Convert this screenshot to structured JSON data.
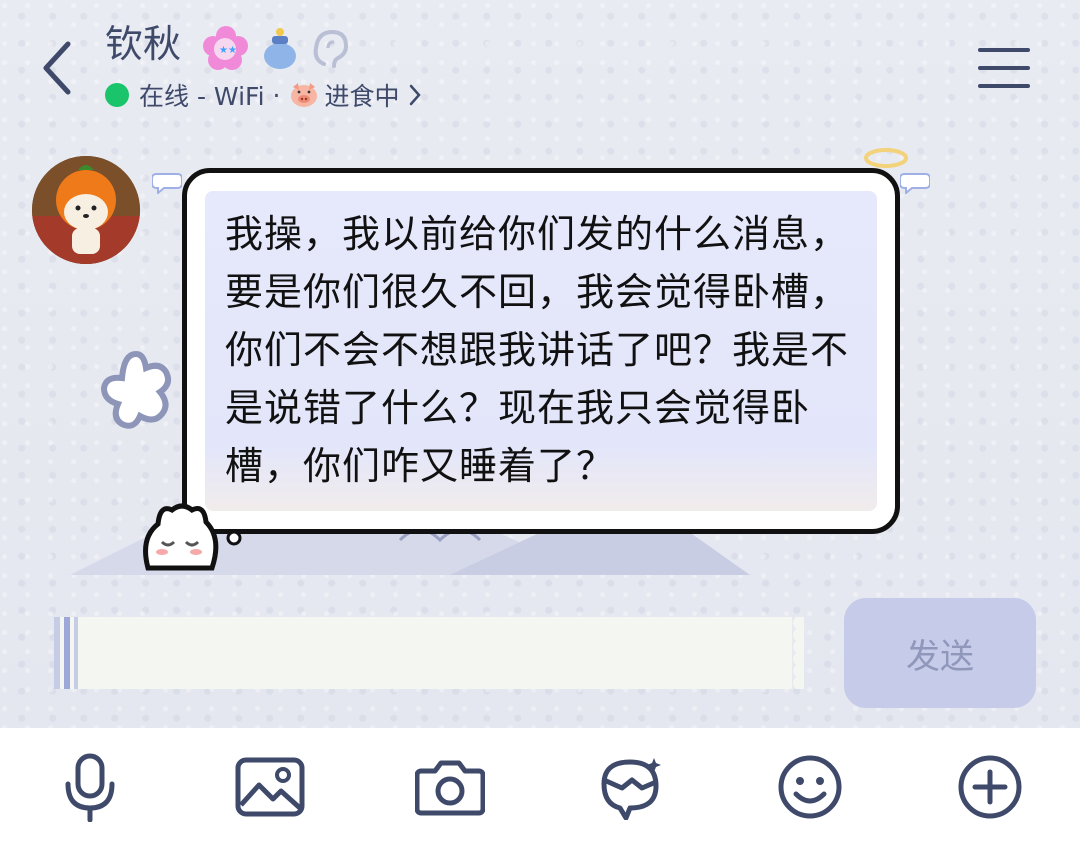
{
  "header": {
    "contact_name": "钦秋",
    "status_text": "在线 - WiFi",
    "separator": "·",
    "activity_text": "进食中",
    "icons": [
      "back-arrow-icon",
      "flower-badge-icon",
      "money-bag-icon",
      "ear-icon",
      "pig-icon",
      "chevron-right-icon",
      "menu-icon"
    ],
    "online_color": "#19c46a"
  },
  "message": {
    "text": "我操，我以前给你们发的什么消息，要是你们很久不回，我会觉得卧槽，你们不会不想跟我讲话了吧？我是不是说错了什么？现在我只会觉得卧槽，你们咋又睡着了？"
  },
  "composer": {
    "value": "",
    "send_label": "发送"
  },
  "toolbar": {
    "items": [
      "microphone-icon",
      "image-icon",
      "camera-icon",
      "sticker-icon",
      "emoji-icon",
      "plus-icon"
    ]
  },
  "colors": {
    "accent": "#3f4a6b",
    "send_bg": "#c5cbe8",
    "send_text": "#8f97ba",
    "bubble_fill": "#e6e8fb"
  }
}
